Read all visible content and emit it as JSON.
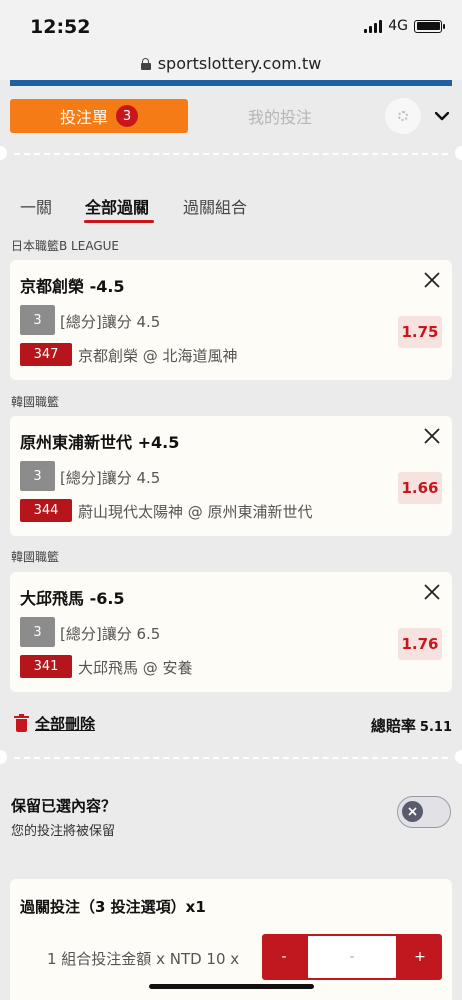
{
  "status": {
    "time": "12:52",
    "network": "4G"
  },
  "browser": {
    "url": "sportslottery.com.tw"
  },
  "header": {
    "bet_slip_label": "投注單",
    "bet_slip_count": "3",
    "my_bets_label": "我的投注"
  },
  "bet_type_tabs": [
    {
      "label": "一關"
    },
    {
      "label": "全部過關",
      "active": true
    },
    {
      "label": "過關組合"
    }
  ],
  "bets": [
    {
      "league": "日本職籃B LEAGUE",
      "selection": "京都創榮 -4.5",
      "qty": "3",
      "market": "[總分]讓分 4.5",
      "game_no": "347",
      "match": "京都創榮 @ 北海道風神",
      "odds": "1.75"
    },
    {
      "league": "韓國職籃",
      "selection": "原州東浦新世代 +4.5",
      "qty": "3",
      "market": "[總分]讓分 4.5",
      "game_no": "344",
      "match": "蔚山現代太陽神 @ 原州東浦新世代",
      "odds": "1.66"
    },
    {
      "league": "韓國職籃",
      "selection": "大邱飛馬 -6.5",
      "qty": "3",
      "market": "[總分]讓分 6.5",
      "game_no": "341",
      "match": "大邱飛馬 @ 安養",
      "odds": "1.76"
    }
  ],
  "footer": {
    "delete_all_label": "全部刪除",
    "total_odds_label": "總賠率",
    "total_odds_value": "5.11"
  },
  "keep_selection": {
    "title": "保留已選內容？",
    "subtitle": "您的投注將被保留",
    "enabled": false
  },
  "parlay": {
    "title": "過關投注（3 投注選項）x1",
    "stake_label": "1 組合投注金額 x NTD 10 x",
    "minus_label": "-",
    "input_placeholder": "-",
    "plus_label": "+"
  },
  "colors": {
    "accent": "#f47b16",
    "brand_red": "#c8161d",
    "url_strip": "#1f5fa6",
    "odds_bg": "#f6e3df"
  },
  "icons": [
    "lock-icon",
    "gear-icon",
    "chevron-down-icon",
    "close-icon",
    "trash-icon",
    "toggle-x-icon"
  ]
}
